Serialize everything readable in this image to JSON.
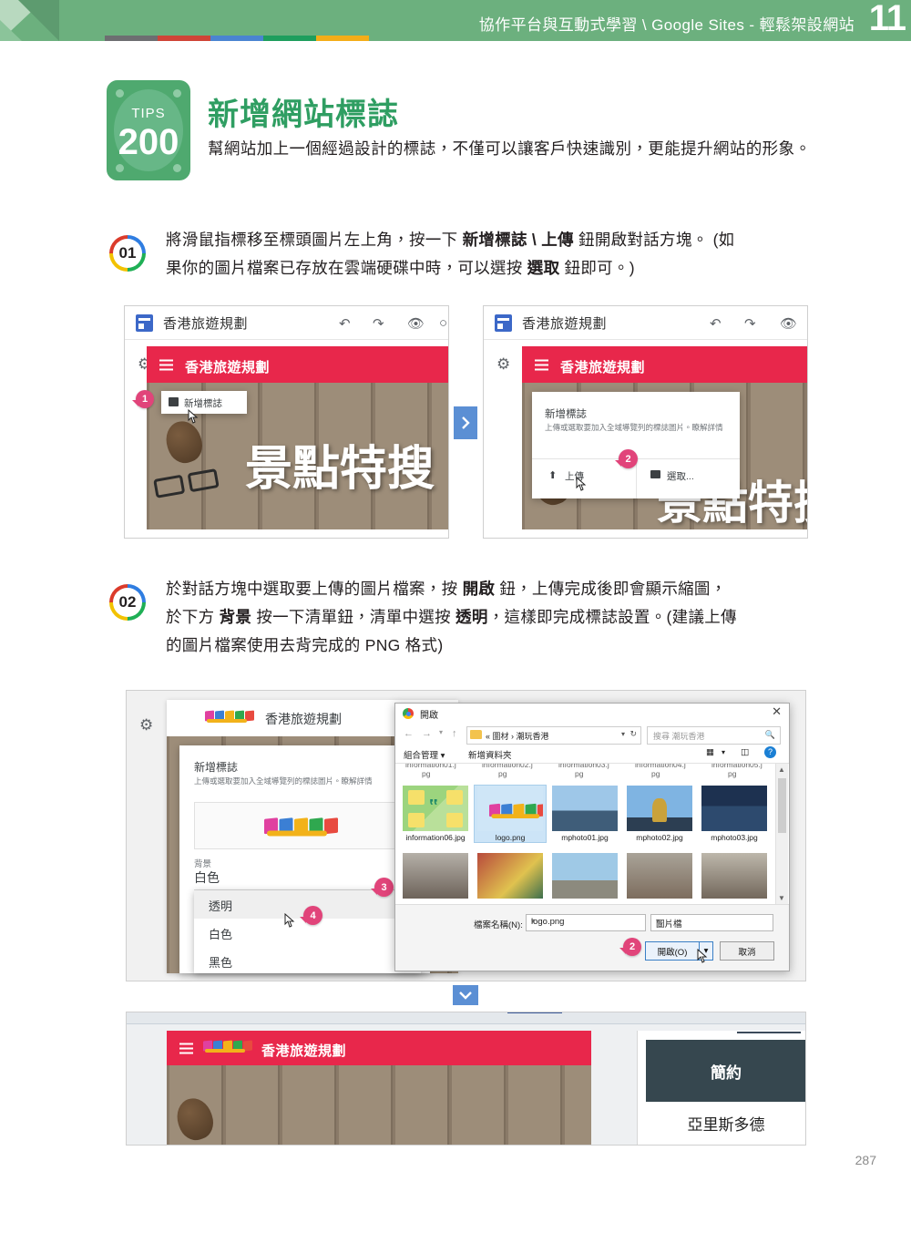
{
  "header": {
    "breadcrumb": "協作平台與互動式學習 \\ Google Sites - 輕鬆架設網站",
    "chapter_number": "11",
    "bar_colors": [
      "#6d6e71",
      "#cf4437",
      "#4a84d1",
      "#1e9e5d",
      "#f4ad18"
    ],
    "band_color": "#6cb07e"
  },
  "tip": {
    "badge_label": "TIPS",
    "badge_number": "200",
    "title": "新增網站標誌",
    "lede": "幫網站加上一個經過設計的標誌，不僅可以讓客戶快速識別，更能提升網站的形象。",
    "accent_color": "#2f9e62"
  },
  "steps": [
    {
      "number": "01",
      "text_line1_a": "將滑鼠指標移至標頭圖片左上角，按一下 ",
      "text_line1_b": "新增標誌 \\ 上傳",
      "text_line1_c": " 鈕開啟對話方塊。 (如",
      "text_line2": "果你的圖片檔案已存放在雲端硬碟中時，可以選按 ",
      "text_line2_b": "選取",
      "text_line2_c": " 鈕即可。)"
    },
    {
      "number": "02",
      "l1a": "於對話方塊中選取要上傳的圖片檔案，按 ",
      "l1b": "開啟",
      "l1c": " 鈕，上傳完成後即會顯示縮圖，",
      "l2a": "於下方 ",
      "l2b": "背景",
      "l2c": " 按一下清單鈕，清單中選按 ",
      "l2d": "透明",
      "l2e": "，這樣即完成標誌設置。(建議上傳",
      "l3": "的圖片檔案使用去背完成的 PNG 格式)"
    }
  ],
  "shot_a": {
    "app_title": "香港旅遊規劃",
    "icons": [
      "undo-icon",
      "redo-icon",
      "preview-icon"
    ],
    "site_title": "香港旅遊規劃",
    "site_header_color": "#e8274b",
    "tooltip_label": "新增標誌",
    "banner_text": "景點特搜",
    "callout": "1"
  },
  "shot_b": {
    "app_title": "香港旅遊規劃",
    "site_title": "香港旅遊規劃",
    "dialog_title": "新增標誌",
    "dialog_desc": "上傳或選取要加入全域導覽列的標誌圖片。瞭解詳情",
    "btn_upload": "上傳",
    "btn_select": "選取...",
    "banner_text": "景點特搜",
    "callout": "2"
  },
  "shot_c": {
    "site_title": "香港旅遊規劃",
    "dialog_title": "新增標誌",
    "dialog_desc": "上傳或選取要加入全域導覽列的標誌圖片。瞭解詳情",
    "bg_label": "背景",
    "bg_value": "白色",
    "bg_options": [
      "透明",
      "白色",
      "黑色"
    ],
    "callout_3": "3",
    "callout_4": "4",
    "delete_icon": "trash-icon"
  },
  "file_dialog": {
    "title": "開啟",
    "close_label": "✕",
    "path": "« 圖材 › 潮玩香港",
    "search_placeholder": "搜尋 潮玩香港",
    "cmd_organize": "組合管理 ▾",
    "cmd_newfolder": "新增資料夾",
    "truncated_row": [
      "information01.j pg",
      "information02.j pg",
      "information03.j pg",
      "information04.j pg",
      "information05.j pg"
    ],
    "files_row1": [
      {
        "name": "information06.jpg",
        "kind": "icon-green",
        "selected": false
      },
      {
        "name": "logo.png",
        "kind": "logo",
        "selected": true
      },
      {
        "name": "mphoto01.jpg",
        "kind": "photo-skyline",
        "selected": false
      },
      {
        "name": "mphoto02.jpg",
        "kind": "photo-bauhinia",
        "selected": false
      },
      {
        "name": "mphoto03.jpg",
        "kind": "photo-night",
        "selected": false
      }
    ],
    "files_row2": [
      {
        "name": "",
        "kind": "photo-tram"
      },
      {
        "name": "",
        "kind": "photo-market"
      },
      {
        "name": "",
        "kind": "photo-sky"
      },
      {
        "name": "",
        "kind": "photo-street"
      },
      {
        "name": "",
        "kind": "photo-tram2"
      }
    ],
    "filename_label": "檔案名稱(N):",
    "filename_value": "logo.png",
    "filetype_value": "圖片檔",
    "btn_open": "開啟(O)",
    "btn_cancel": "取消",
    "callout": "2"
  },
  "shot_d": {
    "site_title": "香港旅遊規劃",
    "panel_title": "簡約",
    "panel_item": "亞里斯多德"
  },
  "connectors": {
    "right_arrow": "chevron-right-icon",
    "down_arrow": "chevron-down-icon",
    "color": "#5b8fd4"
  },
  "page_number": "287"
}
